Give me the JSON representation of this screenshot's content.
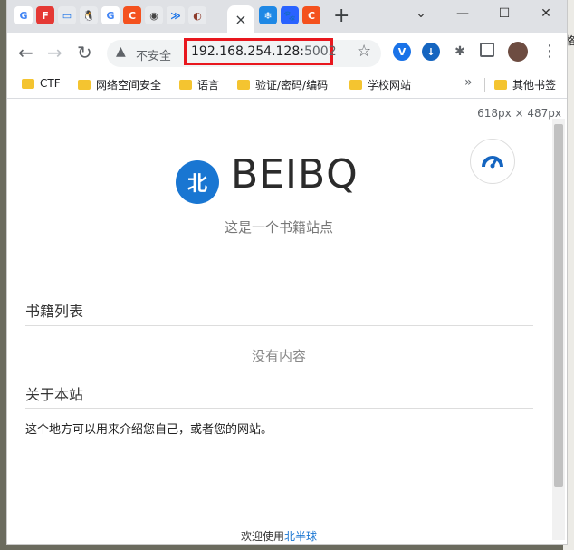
{
  "desktop": {
    "side_glyph": "格"
  },
  "browser": {
    "tabs": [
      {
        "icon": "google-icon",
        "glyph": "G",
        "color": "#ffffff",
        "fg": "#4285f4"
      },
      {
        "icon": "app-icon",
        "glyph": "F",
        "color": "#e53935",
        "fg": "#ffffff"
      },
      {
        "icon": "monitor-icon",
        "glyph": "▭",
        "color": "#e8eaed",
        "fg": "#1a73e8"
      },
      {
        "icon": "linux-icon",
        "glyph": "🐧",
        "color": "#e8eaed",
        "fg": "#333333"
      },
      {
        "icon": "google-icon",
        "glyph": "G",
        "color": "#ffffff",
        "fg": "#4285f4"
      },
      {
        "icon": "c-icon",
        "glyph": "C",
        "color": "#f4511e",
        "fg": "#ffffff"
      },
      {
        "icon": "globe-icon",
        "glyph": "◉",
        "color": "#e8eaed",
        "fg": "#444444"
      },
      {
        "icon": "chevron-icon",
        "glyph": "≫",
        "color": "#e8eaed",
        "fg": "#1a73e8"
      },
      {
        "icon": "shield-icon",
        "glyph": "◐",
        "color": "#e8eaed",
        "fg": "#8d3b2b"
      }
    ],
    "active_tab_close": "×",
    "after_tabs": [
      {
        "icon": "snowflake-icon",
        "glyph": "❄",
        "color": "#1e88e5",
        "fg": "#ffffff"
      },
      {
        "icon": "baidu-icon",
        "glyph": "🐾",
        "color": "#2962ff",
        "fg": "#ffffff"
      },
      {
        "icon": "c-icon",
        "glyph": "C",
        "color": "#f4511e",
        "fg": "#ffffff"
      }
    ],
    "new_tab": "+",
    "window_controls": {
      "chevron": "⌄",
      "minimize": "—",
      "maximize": "☐",
      "close": "✕"
    },
    "toolbar": {
      "back": "←",
      "forward": "→",
      "reload": "↻",
      "security_warning": "▲",
      "insecure_label": "不安全",
      "url_host": "192.168.254.128:",
      "url_port": "5002",
      "star": "☆",
      "more": "⋮"
    },
    "bookmarks": [
      {
        "label": "CTF"
      },
      {
        "label": "网络空间安全"
      },
      {
        "label": "语言"
      },
      {
        "label": "验证/密码/编码"
      },
      {
        "label": "学校网站"
      }
    ],
    "bookmarks_more": "»",
    "other_bookmarks": "其他书签"
  },
  "page": {
    "dimensions": "618px × 487px",
    "logo_char": "北",
    "title": "BEIBQ",
    "tagline": "这是一个书籍站点",
    "books_heading": "书籍列表",
    "empty_text": "没有内容",
    "about_heading": "关于本站",
    "about_text": "这个地方可以用来介绍您自己，或者您的网站。",
    "footer_prefix": "欢迎使用",
    "footer_link": "北半球"
  }
}
